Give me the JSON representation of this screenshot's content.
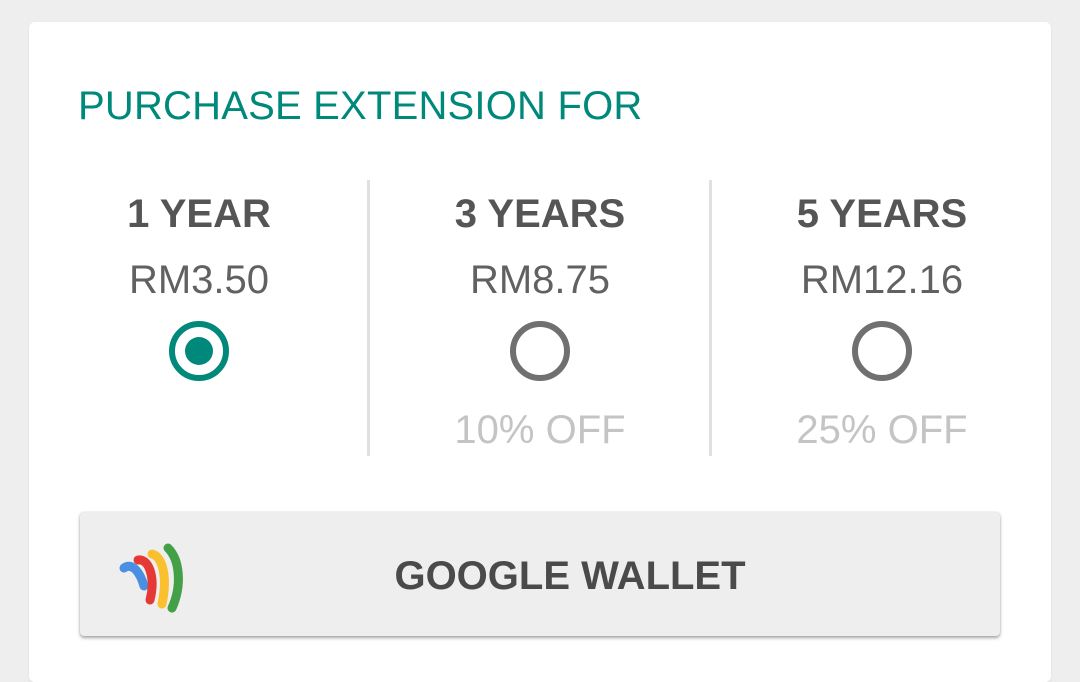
{
  "heading": "PURCHASE EXTENSION FOR",
  "options": [
    {
      "term": "1 YEAR",
      "price": "RM3.50",
      "discount": "",
      "selected": true
    },
    {
      "term": "3 YEARS",
      "price": "RM8.75",
      "discount": "10% OFF",
      "selected": false
    },
    {
      "term": "5 YEARS",
      "price": "RM12.16",
      "discount": "25% OFF",
      "selected": false
    }
  ],
  "payment_button": {
    "label": "GOOGLE WALLET",
    "icon": "google-wallet-icon"
  },
  "colors": {
    "accent": "#00897b",
    "background": "#eeeeee",
    "card": "#ffffff",
    "radio_unselected": "#707070",
    "discount_text": "#c4c4c4"
  }
}
